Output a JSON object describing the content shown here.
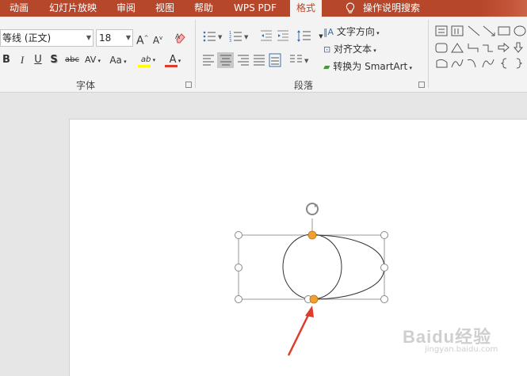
{
  "tabs": [
    {
      "label": "动画",
      "active": false
    },
    {
      "label": "幻灯片放映",
      "active": false
    },
    {
      "label": "审阅",
      "active": false
    },
    {
      "label": "视图",
      "active": false
    },
    {
      "label": "帮助",
      "active": false
    },
    {
      "label": "WPS PDF",
      "active": false
    },
    {
      "label": "格式",
      "active": true
    },
    {
      "label": "操作说明搜索",
      "active": false
    }
  ],
  "font": {
    "name": "等线 (正文)",
    "size": "18",
    "grow_icon": "A",
    "shrink_icon": "A",
    "bold": "B",
    "italic": "I",
    "underline": "U",
    "shadow": "S",
    "strike": "abc",
    "spacing": "AV",
    "case": "Aa",
    "highlight": "ab",
    "color": "A",
    "group_label": "字体"
  },
  "paragraph": {
    "text_direction": "文字方向",
    "align_text": "对齐文本",
    "smartart": "转换为 SmartArt",
    "group_label": "段落"
  },
  "colors": {
    "brand": "#b7472a",
    "handle_fill": "#ffffff",
    "adjust_handle": "#f0a030",
    "arrow": "#e03a2a",
    "highlight_bar": "#ffff00",
    "font_color_bar": "#e03a2a"
  },
  "watermark": {
    "text": "Baidu经验",
    "sub": "jingyan.baidu.com"
  }
}
